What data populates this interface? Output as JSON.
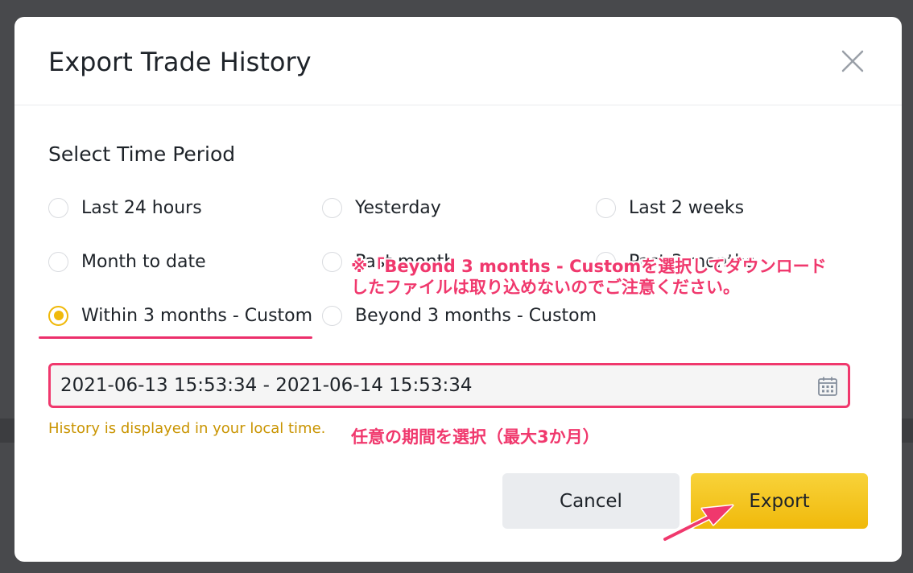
{
  "dialog": {
    "title": "Export Trade History",
    "close_icon": "close-icon"
  },
  "time_period": {
    "heading": "Select Time Period",
    "options": [
      {
        "label": "Last 24 hours",
        "selected": false
      },
      {
        "label": "Yesterday",
        "selected": false
      },
      {
        "label": "Last 2 weeks",
        "selected": false
      },
      {
        "label": "Month to date",
        "selected": false
      },
      {
        "label": "Past month",
        "selected": false
      },
      {
        "label": "Past 3 months",
        "selected": false
      },
      {
        "label": "Within 3 months - Custom",
        "selected": true
      },
      {
        "label": "Beyond 3 months - Custom",
        "selected": false
      }
    ]
  },
  "date_range": {
    "value": "2021-06-13 15:53:34 - 2021-06-14 15:53:34",
    "icon": "calendar-icon"
  },
  "hint": "History is displayed in your local time.",
  "annotations": {
    "warning_line1": "※「Beyond 3 months - Customを選択してダウンロード",
    "warning_line2": "したファイルは取り込めないのでご注意ください。",
    "range_note": "任意の期間を選択（最大3か月）"
  },
  "buttons": {
    "cancel": "Cancel",
    "export": "Export"
  },
  "colors": {
    "accent": "#f0b90b",
    "annotation": "#f0386d",
    "hint": "#c99400"
  }
}
